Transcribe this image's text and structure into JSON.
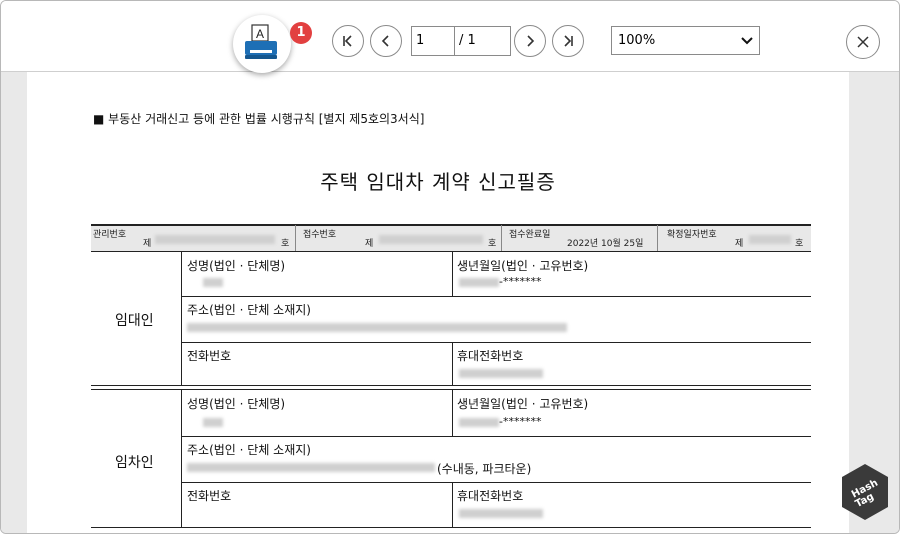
{
  "toolbar": {
    "badge": "1",
    "page_current": "1",
    "page_total": "/ 1",
    "zoom_value": "100%",
    "print_glyph": "A"
  },
  "document": {
    "header_line": "■ 부동산 거래신고 등에 관한 법률 시행규칙 [별지 제5호의3서식]",
    "title": "주택 임대차 계약 신고필증",
    "meta": {
      "mgmt_no_label": "관리번호",
      "receipt_no_label": "접수번호",
      "receipt_done_label": "접수완료일",
      "receipt_date": "2022년 10월 25일",
      "fixed_date_no_label": "확정일자번호",
      "je": "제",
      "ho": "호"
    },
    "lessor": {
      "role": "임대인",
      "name_label": "성명(법인 · 단체명)",
      "birth_label": "생년월일(법인 · 고유번호)",
      "birth_suffix": "-*******",
      "address_label": "주소(법인 · 단체 소재지)",
      "phone_label": "전화번호",
      "mobile_label": "휴대전화번호"
    },
    "lessee": {
      "role": "임차인",
      "name_label": "성명(법인 · 단체명)",
      "birth_label": "생년월일(법인 · 고유번호)",
      "birth_suffix": "-*******",
      "address_label": "주소(법인 · 단체 소재지)",
      "address_suffix": "(수내동, 파크타운)",
      "phone_label": "전화번호",
      "mobile_label": "휴대전화번호"
    }
  },
  "watermark": {
    "line1": "Hash",
    "line2": "Tag"
  },
  "colors": {
    "badge": "#e24040",
    "printer": "#1e6fb5",
    "viewer_bg": "#e9e9e9"
  }
}
